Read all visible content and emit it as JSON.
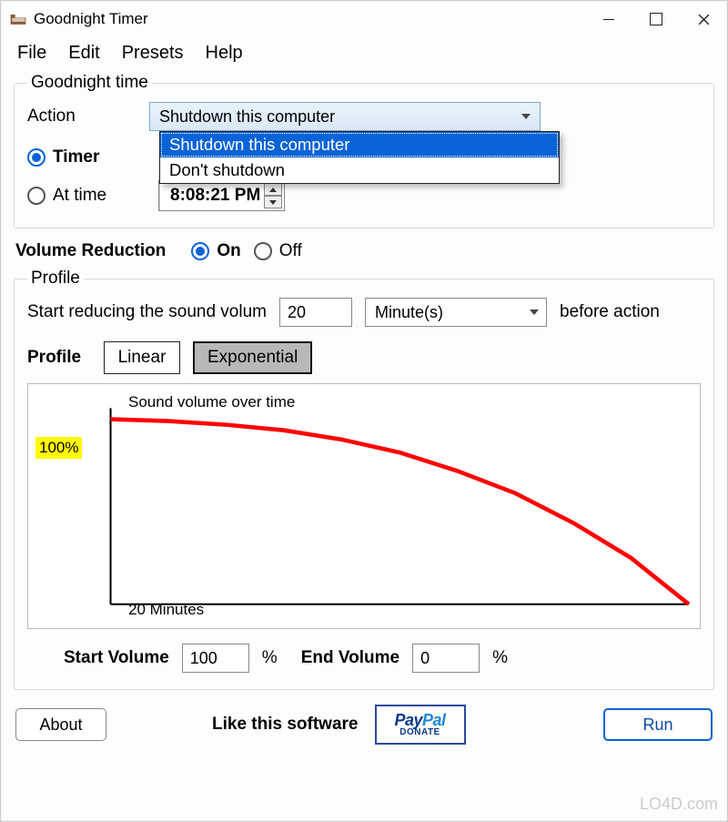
{
  "window": {
    "title": "Goodnight Timer"
  },
  "menu": {
    "file": "File",
    "edit": "Edit",
    "presets": "Presets",
    "help": "Help"
  },
  "goodnight": {
    "legend": "Goodnight time",
    "action_label": "Action",
    "action_value": "Shutdown this computer",
    "options": [
      "Shutdown this computer",
      "Don't shutdown"
    ],
    "timer_label": "Timer",
    "attime_label": "At time",
    "time_value": "8:08:21 PM"
  },
  "volred": {
    "label": "Volume Reduction",
    "on": "On",
    "off": "Off"
  },
  "profile": {
    "legend": "Profile",
    "start_text": "Start reducing the sound volum",
    "start_value": "20",
    "unit": "Minute(s)",
    "after_text": "before action",
    "profile_label": "Profile",
    "linear": "Linear",
    "exponential": "Exponential",
    "startvol_label": "Start Volume",
    "startvol_value": "100",
    "endvol_label": "End Volume",
    "endvol_value": "0",
    "pct": "%"
  },
  "footer": {
    "about": "About",
    "like": "Like this software",
    "donate": "DONATE",
    "run": "Run"
  },
  "watermark": "LO4D.com",
  "chart_data": {
    "type": "line",
    "title": "Sound volume over time",
    "xlabel": "20 Minutes",
    "ylabel_badge": "100%",
    "ylim": [
      0,
      100
    ],
    "x": [
      0,
      2,
      4,
      6,
      8,
      10,
      12,
      14,
      16,
      18,
      20
    ],
    "values": [
      100,
      99,
      97,
      94,
      89,
      82,
      72,
      60,
      44,
      25,
      0
    ],
    "series_color": "#ff0000"
  }
}
